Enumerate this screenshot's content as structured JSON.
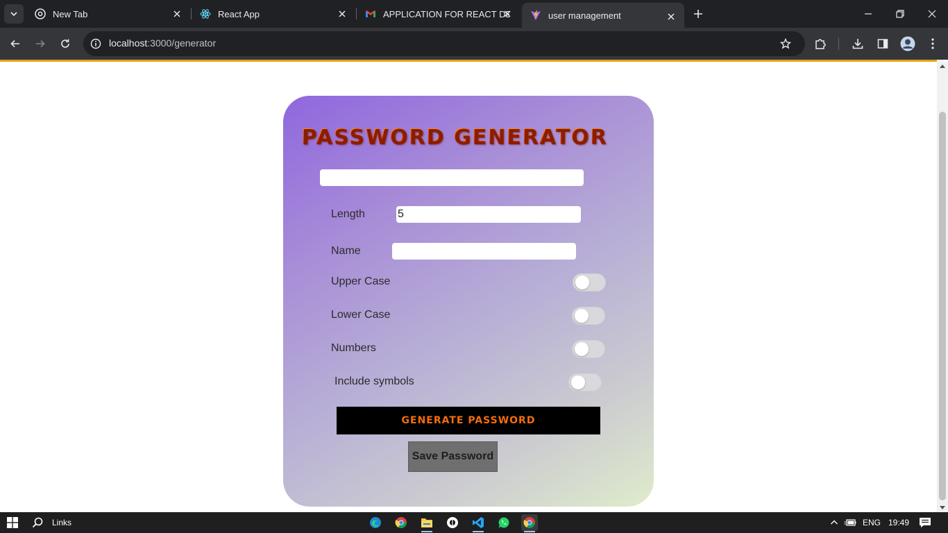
{
  "browser": {
    "tabs": [
      {
        "title": "New Tab",
        "icon": "chrome-icon"
      },
      {
        "title": "React App",
        "icon": "react-icon"
      },
      {
        "title": "APPLICATION FOR REACT DEVE",
        "icon": "gmail-icon"
      },
      {
        "title": "user management",
        "icon": "vite-icon",
        "active": true
      }
    ],
    "url_host": "localhost",
    "url_path": ":3000/generator"
  },
  "generator": {
    "title": "PASSWORD GENERATOR",
    "password_value": "",
    "length_label": "Length",
    "length_value": "5",
    "name_label": "Name",
    "name_value": "",
    "options": [
      {
        "label": "Upper Case",
        "checked": false
      },
      {
        "label": "Lower Case",
        "checked": false
      },
      {
        "label": "Numbers",
        "checked": false
      },
      {
        "label": "Include symbols",
        "checked": false
      }
    ],
    "generate_label": "GENERATE PASSWORD",
    "save_label": "Save Password"
  },
  "taskbar": {
    "search_label": "Links",
    "language": "ENG",
    "time": "19:49"
  },
  "colors": {
    "accent_orange": "#f46d0c",
    "loading_bar": "#e8a317",
    "card_gradient_start": "#8f67de",
    "card_gradient_end": "#dfeccb"
  }
}
